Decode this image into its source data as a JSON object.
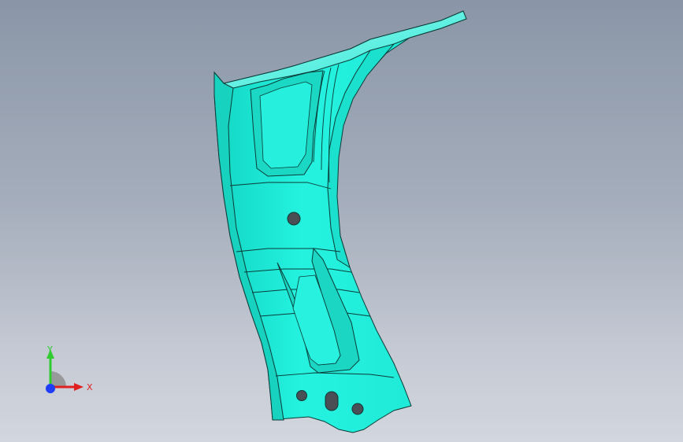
{
  "viewport": {
    "background_top": "#8a96a7",
    "background_bottom": "#d2d6de"
  },
  "part": {
    "face_color": "#22f0dd",
    "shade_color": "#14c9b8",
    "edge_color": "#0b3b36",
    "hole_color": "#4a4e55"
  },
  "triad": {
    "x_label": "X",
    "y_label": "Y",
    "x_color": "#e02020",
    "y_color": "#2ecc2e",
    "z_color": "#1f3cff"
  }
}
